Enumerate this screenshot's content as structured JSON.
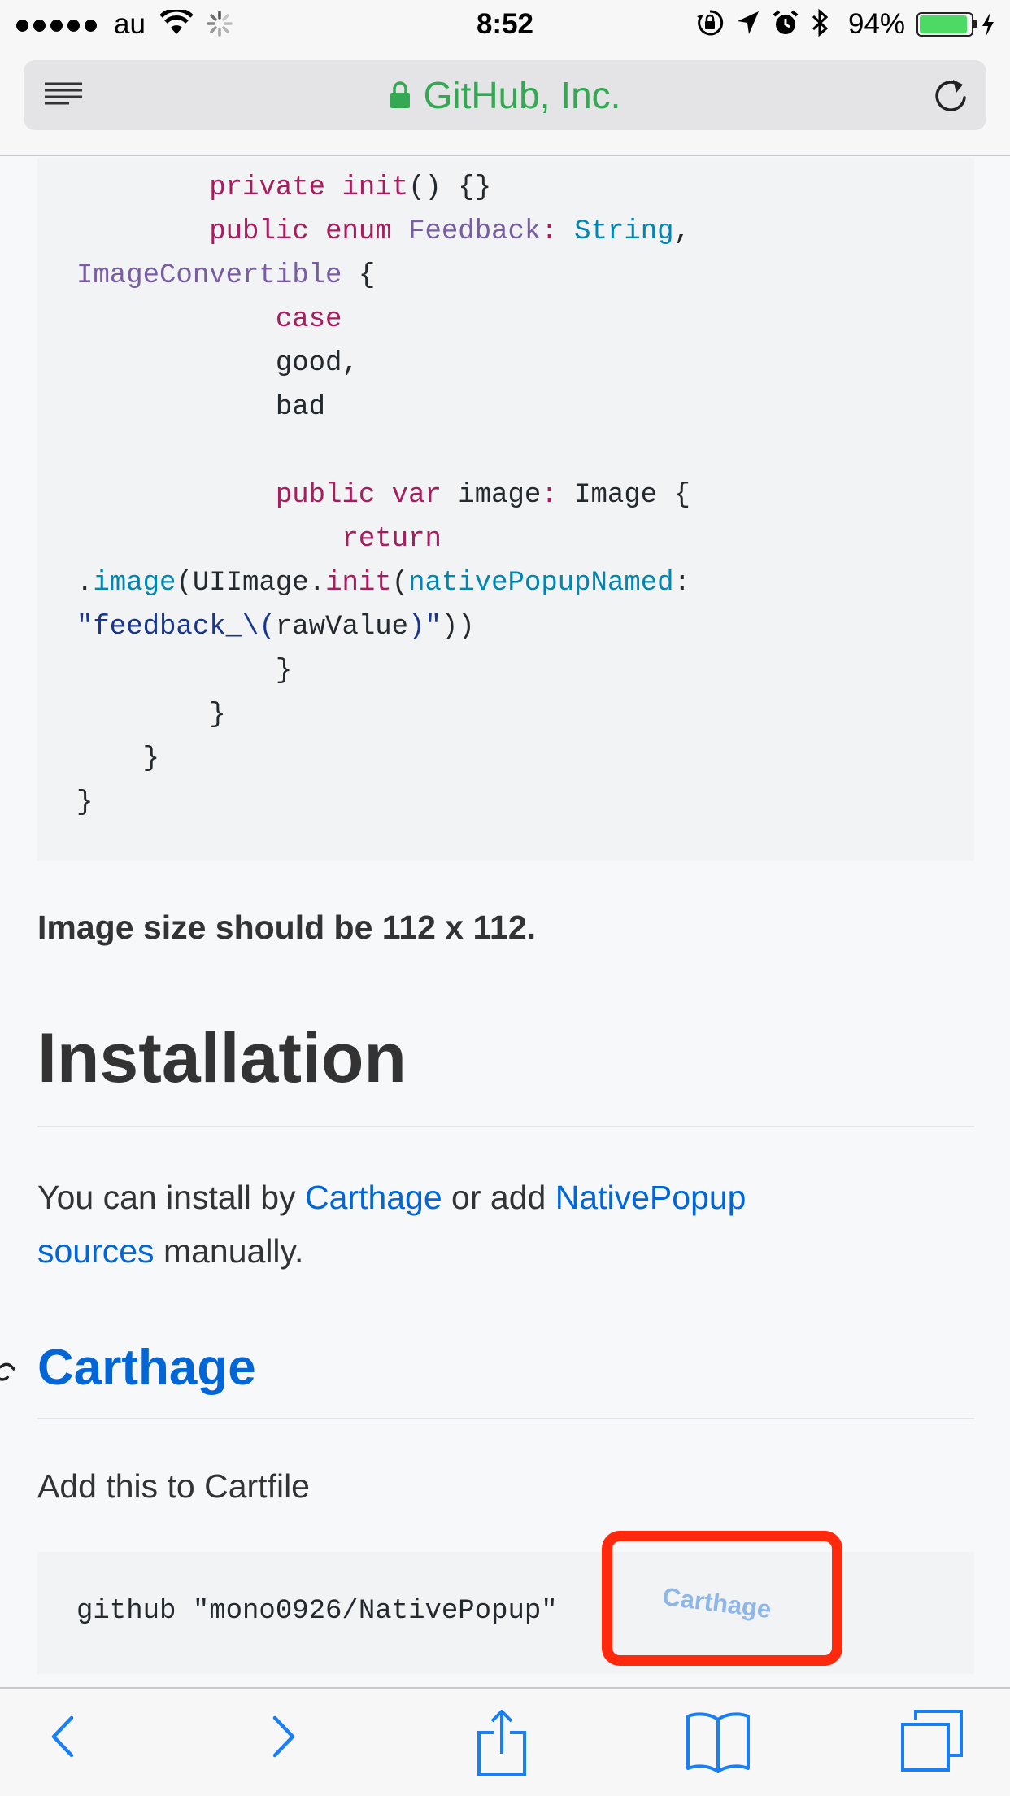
{
  "status_bar": {
    "carrier": "au",
    "time": "8:52",
    "battery_percent": "94%",
    "battery_level": 0.94,
    "icons": [
      "signal-dots-icon",
      "wifi-icon",
      "activity-spinner-icon",
      "rotation-lock-icon",
      "location-arrow-icon",
      "alarm-icon",
      "bluetooth-icon",
      "battery-icon",
      "charging-bolt-icon"
    ]
  },
  "url_bar": {
    "title": "GitHub, Inc.",
    "icons": [
      "reader-view-icon",
      "lock-icon",
      "reload-icon"
    ]
  },
  "code_block": {
    "lines": [
      "        private init() {}",
      "        public enum Feedback: String,",
      "ImageConvertible {",
      "            case",
      "            good,",
      "            bad",
      "",
      "            public var image: Image {",
      "                return",
      ".image(UIImage.init(nativePopupNamed:",
      "\"feedback_\\(rawValue)\"))",
      "            }",
      "        }",
      "    }",
      "}"
    ]
  },
  "image_size_note": "Image size should be 112 x 112.",
  "installation": {
    "heading": "Installation",
    "text_1": "You can install by ",
    "link_carthage": "Carthage",
    "text_2": " or add ",
    "link_sources_1": "NativePopup",
    "link_sources_2": "sources",
    "text_3": " manually."
  },
  "carthage": {
    "heading": "Carthage",
    "instruction": "Add this to Cartfile",
    "code": "github \"mono0926/NativePopup\"",
    "overlay_label": "Carthage"
  },
  "toolbar": {
    "icons": [
      "back-icon",
      "forward-icon",
      "share-icon",
      "bookmarks-icon",
      "tabs-icon"
    ]
  },
  "colors": {
    "link": "#0366d6",
    "url_green": "#35a853",
    "keyword": "#a71d5d",
    "type": "#795da3",
    "builtin": "#0086b3",
    "string": "#183691",
    "annotation_red": "#ff2a0e",
    "safari_blue": "#1a7ef5"
  }
}
